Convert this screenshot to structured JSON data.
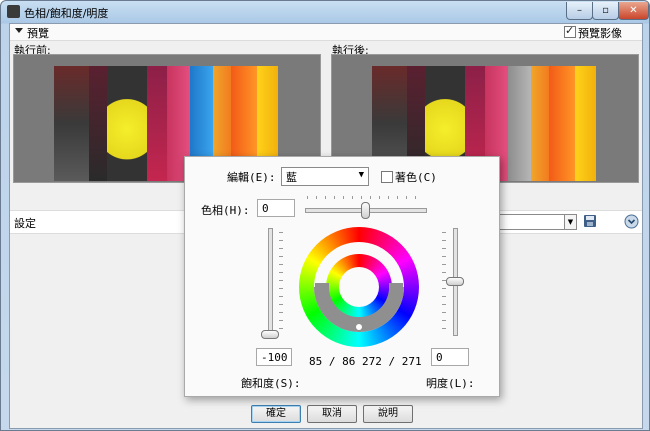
{
  "window": {
    "title": "色相/飽和度/明度",
    "controls": {
      "minimize": "–",
      "maximize": "▫",
      "close": "✕"
    }
  },
  "preview": {
    "section_label": "預覽",
    "show_preview_label": "預覽影像",
    "show_preview_checked": true,
    "before_label": "執行前:",
    "after_label": "執行後:"
  },
  "settings": {
    "label": "設定",
    "preset_value": "",
    "icons": {
      "save": "save-icon",
      "options": "chevron-down-icon"
    }
  },
  "dialog": {
    "edit_label": "編輯(E):",
    "edit_value": "藍",
    "colorize_label": "著色(C)",
    "colorize_checked": false,
    "hue_label": "色相(H):",
    "hue_value": "0",
    "saturation_value": "-100",
    "saturation_label": "飽和度(S):",
    "lightness_value": "0",
    "lightness_label": "明度(L):",
    "readout": "85 / 86   272 / 271",
    "hue_level": 0.5,
    "saturation_level": 0.0,
    "lightness_level": 0.5
  },
  "buttons": {
    "ok": "確定",
    "cancel": "取消",
    "help": "說明"
  },
  "colors": {
    "accent": "#3c7fb1",
    "dialog_bg": "#fafafa",
    "panel_bg": "#7a7a7a"
  }
}
